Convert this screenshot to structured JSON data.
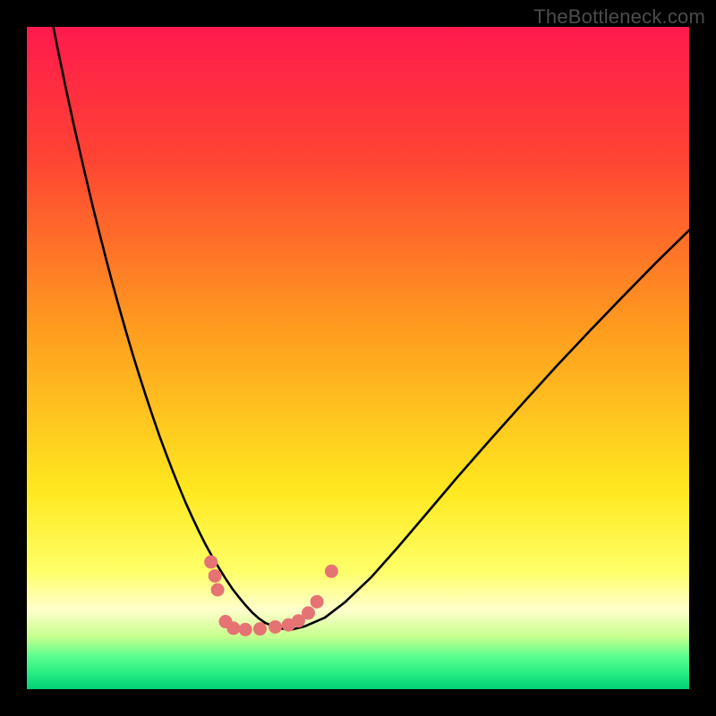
{
  "watermark": "TheBottleneck.com",
  "chart_data": {
    "type": "line",
    "title": "",
    "xlabel": "",
    "ylabel": "",
    "xlim": [
      0,
      100
    ],
    "ylim": [
      0,
      100
    ],
    "background_gradient_stops": [
      {
        "pos": 0.0,
        "color": "#ff1a4d"
      },
      {
        "pos": 0.2,
        "color": "#ff4433"
      },
      {
        "pos": 0.45,
        "color": "#ff9a1f"
      },
      {
        "pos": 0.7,
        "color": "#ffe81f"
      },
      {
        "pos": 0.82,
        "color": "#ffff66"
      },
      {
        "pos": 0.88,
        "color": "#ffffcc"
      },
      {
        "pos": 0.92,
        "color": "#c9ff8f"
      },
      {
        "pos": 0.95,
        "color": "#5cff8f"
      },
      {
        "pos": 0.98,
        "color": "#20e880"
      },
      {
        "pos": 1.0,
        "color": "#00d078"
      }
    ],
    "series": [
      {
        "name": "bottleneck-curve",
        "color": "#000000",
        "stroke_width": 2.6,
        "x": [
          4,
          5,
          6,
          7,
          8,
          9,
          10,
          11,
          12,
          13,
          14,
          15,
          16,
          17,
          18,
          19,
          20,
          21,
          22,
          23,
          24,
          25,
          26,
          27,
          28,
          29,
          30,
          31,
          32,
          33,
          34,
          35,
          36,
          38,
          40,
          42,
          45,
          48,
          52,
          56,
          60,
          65,
          70,
          75,
          80,
          85,
          90,
          95,
          100
        ],
        "y": [
          100,
          95,
          90.2,
          85.6,
          81.2,
          76.9,
          72.7,
          68.7,
          64.8,
          61.0,
          57.4,
          53.9,
          50.5,
          47.3,
          44.2,
          41.2,
          38.3,
          35.6,
          33.0,
          30.5,
          28.1,
          25.9,
          23.8,
          21.8,
          20.0,
          18.3,
          16.7,
          15.2,
          13.9,
          12.7,
          11.6,
          10.7,
          10.0,
          9.2,
          9.0,
          9.5,
          10.8,
          13.1,
          16.9,
          21.4,
          26.1,
          32.0,
          37.7,
          43.3,
          48.8,
          54.1,
          59.3,
          64.4,
          69.3
        ]
      }
    ],
    "scatter_overlay": {
      "name": "data-points",
      "color": "#e57373",
      "radius": 7.5,
      "points": [
        {
          "x": 27.8,
          "y": 19.2
        },
        {
          "x": 28.4,
          "y": 17.1
        },
        {
          "x": 28.8,
          "y": 15.0
        },
        {
          "x": 30.0,
          "y": 10.2
        },
        {
          "x": 31.2,
          "y": 9.2
        },
        {
          "x": 33.0,
          "y": 9.0
        },
        {
          "x": 35.2,
          "y": 9.1
        },
        {
          "x": 37.5,
          "y": 9.4
        },
        {
          "x": 39.5,
          "y": 9.7
        },
        {
          "x": 41.0,
          "y": 10.3
        },
        {
          "x": 42.5,
          "y": 11.5
        },
        {
          "x": 43.8,
          "y": 13.2
        },
        {
          "x": 46.0,
          "y": 17.8
        }
      ]
    }
  }
}
